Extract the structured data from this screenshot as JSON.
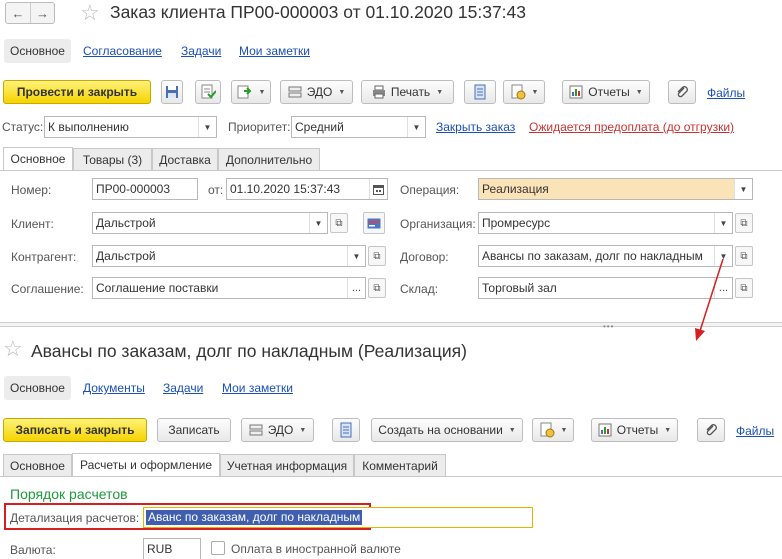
{
  "top_form": {
    "title": "Заказ клиента ПР00-000003 от 01.10.2020 15:37:43",
    "nav_tabs": [
      "Основное",
      "Согласование",
      "Задачи",
      "Мои заметки"
    ],
    "toolbar": {
      "post_close": "Провести и закрыть",
      "edo": "ЭДО",
      "print": "Печать",
      "reports": "Отчеты",
      "files": "Файлы"
    },
    "status_label": "Статус:",
    "status_value": "К выполнению",
    "priority_label": "Приоритет:",
    "priority_value": "Средний",
    "close_order_link": "Закрыть заказ",
    "prepay_link": "Ожидается предоплата (до отгрузки)",
    "tabs": [
      "Основное",
      "Товары (3)",
      "Доставка",
      "Дополнительно"
    ],
    "number_label": "Номер:",
    "number_value": "ПР00-000003",
    "date_label": "от:",
    "date_value": "01.10.2020 15:37:43",
    "operation_label": "Операция:",
    "operation_value": "Реализация",
    "client_label": "Клиент:",
    "client_value": "Дальстрой",
    "org_label": "Организация:",
    "org_value": "Промресурс",
    "contractor_label": "Контрагент:",
    "contractor_value": "Дальстрой",
    "contract_label": "Договор:",
    "contract_value": "Авансы по заказам, долг по накладным",
    "agreement_label": "Соглашение:",
    "agreement_value": "Соглашение поставки",
    "warehouse_label": "Склад:",
    "warehouse_value": "Торговый зал"
  },
  "bottom_form": {
    "title": "Авансы по заказам, долг по накладным (Реализация)",
    "nav_tabs": [
      "Основное",
      "Документы",
      "Задачи",
      "Мои заметки"
    ],
    "toolbar": {
      "save_close": "Записать и закрыть",
      "save": "Записать",
      "edo": "ЭДО",
      "create_based": "Создать на основании",
      "reports": "Отчеты",
      "files": "Файлы"
    },
    "tabs": [
      "Основное",
      "Расчеты и оформление",
      "Учетная информация",
      "Комментарий"
    ],
    "section_title": "Порядок расчетов",
    "detail_label": "Детализация расчетов:",
    "detail_value": "Аванс по заказам, долг по накладным",
    "currency_label": "Валюта:",
    "currency_value": "RUB",
    "foreign_currency_label": "Оплата в иностранной валюте"
  },
  "colors": {
    "accent_yellow": "#f5d400",
    "link_blue": "#1a4fb5",
    "link_red": "#c83232",
    "section_green": "#1e9a3c",
    "highlight_red": "#d42020",
    "selection_blue": "#3f5fae"
  }
}
